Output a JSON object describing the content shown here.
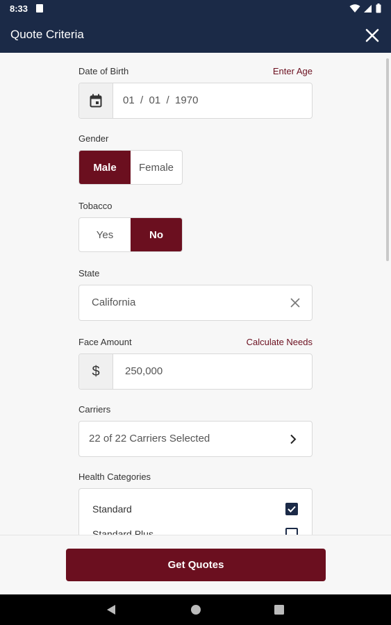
{
  "status_bar": {
    "time": "8:33"
  },
  "app_bar": {
    "title": "Quote Criteria",
    "close_icon": "close-icon"
  },
  "dob": {
    "label": "Date of Birth",
    "link": "Enter Age",
    "value": "01  /  01  /  1970",
    "icon": "calendar-icon"
  },
  "gender": {
    "label": "Gender",
    "options": [
      "Male",
      "Female"
    ],
    "selected": "Male"
  },
  "tobacco": {
    "label": "Tobacco",
    "options": [
      "Yes",
      "No"
    ],
    "selected": "No"
  },
  "state": {
    "label": "State",
    "value": "California"
  },
  "face_amount": {
    "label": "Face Amount",
    "link": "Calculate Needs",
    "currency": "$",
    "value": "250,000"
  },
  "carriers": {
    "label": "Carriers",
    "value": "22 of 22 Carriers Selected"
  },
  "health": {
    "label": "Health Categories",
    "items": [
      {
        "label": "Standard",
        "checked": true
      },
      {
        "label": "Standard Plus",
        "checked": false
      }
    ]
  },
  "footer": {
    "button": "Get Quotes"
  },
  "colors": {
    "navy": "#1b2a47",
    "maroon": "#6b0f1f"
  }
}
